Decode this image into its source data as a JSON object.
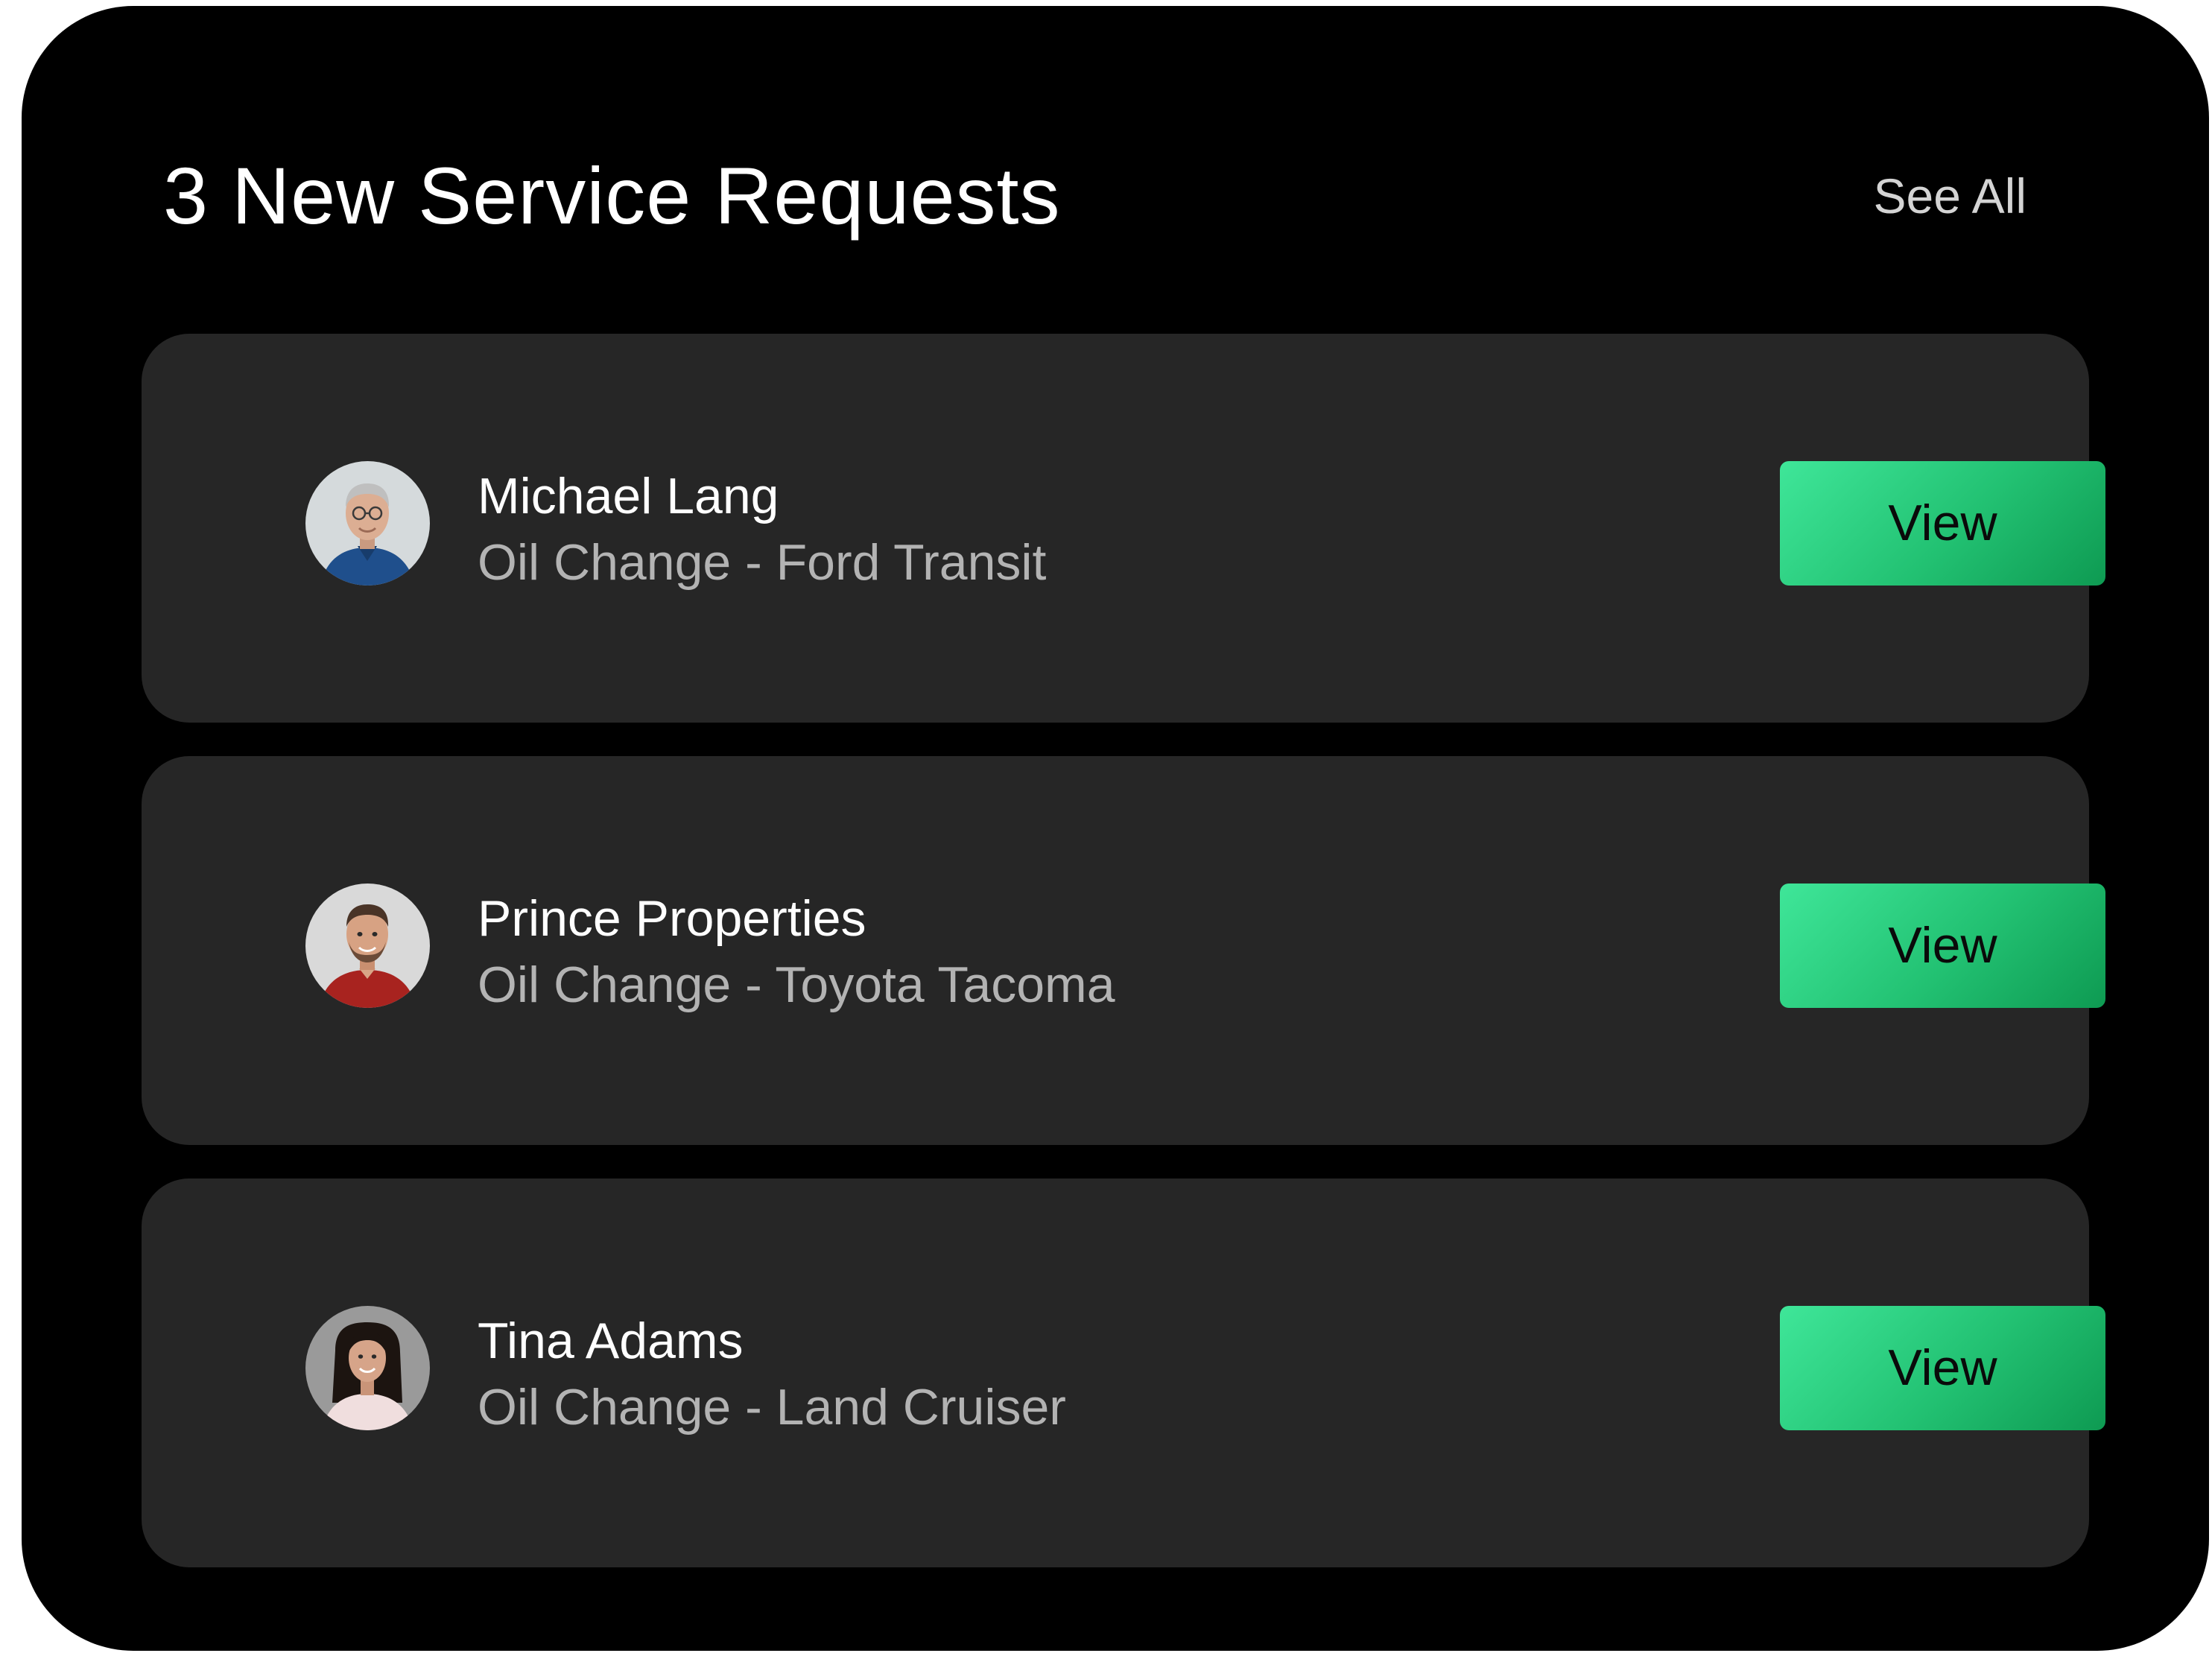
{
  "header": {
    "title": "3 New Service Requests",
    "see_all_label": "See All"
  },
  "requests": [
    {
      "name": "Michael Lang",
      "service": "Oil Change - Ford Transit",
      "action_label": "View",
      "avatar_icon": "person-photo-older-man"
    },
    {
      "name": "Prince Properties",
      "service": "Oil Change - Toyota Tacoma",
      "action_label": "View",
      "avatar_icon": "person-photo-young-man"
    },
    {
      "name": "Tina Adams",
      "service": "Oil Change - Land Cruiser",
      "action_label": "View",
      "avatar_icon": "person-photo-woman"
    }
  ],
  "colors": {
    "panel_background": "#000000",
    "card_background": "#262626",
    "button_gradient_start": "#3fe699",
    "button_gradient_end": "#0e9a52",
    "title_text": "#ffffff",
    "secondary_text": "#b3b3b3"
  }
}
